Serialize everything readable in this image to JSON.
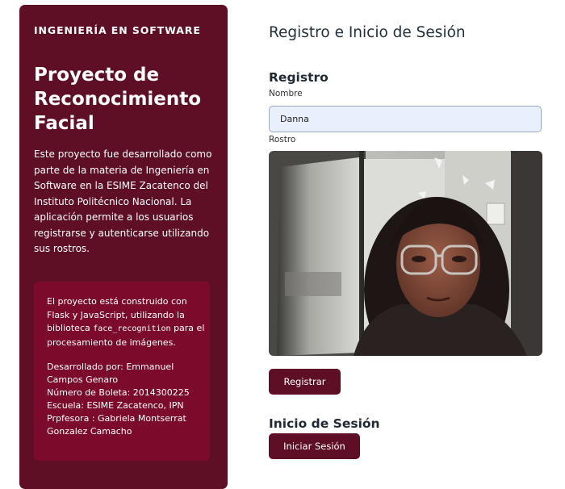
{
  "sidebar": {
    "tag": "INGENIERÍA EN SOFTWARE",
    "title": "Proyecto de Reconocimiento Facial",
    "description": "Este proyecto fue desarrollado como parte de la materia de Ingeniería en Software en la ESIME Zacatenco del Instituto Politécnico Nacional. La aplicación permite a los usuarios registrarse y autenticarse utilizando sus rostros.",
    "info": {
      "tech_prefix": "El proyecto está construido con Flask y JavaScript, utilizando la biblioteca",
      "tech_code": "face_recognition",
      "tech_suffix": "para el procesamiento de imágenes.",
      "developer": "Desarrollado por: Emmanuel Campos Genaro",
      "boleta": "Número de Boleta: 2014300225",
      "school": "Escuela: ESIME Zacatenco, IPN",
      "teacher": "Prpfesora : Gabriela Montserrat Gonzalez Camacho"
    }
  },
  "main": {
    "title": "Registro e Inicio de Sesión",
    "register": {
      "heading": "Registro",
      "name_label": "Nombre",
      "name_value": "Danna",
      "face_label": "Rostro",
      "button": "Registrar"
    },
    "login": {
      "heading": "Inicio de Sesión",
      "button": "Iniciar Sesión"
    }
  },
  "colors": {
    "accent": "#5e0f25",
    "card": "#7b0a2b",
    "input_bg": "#e8f0fe"
  }
}
